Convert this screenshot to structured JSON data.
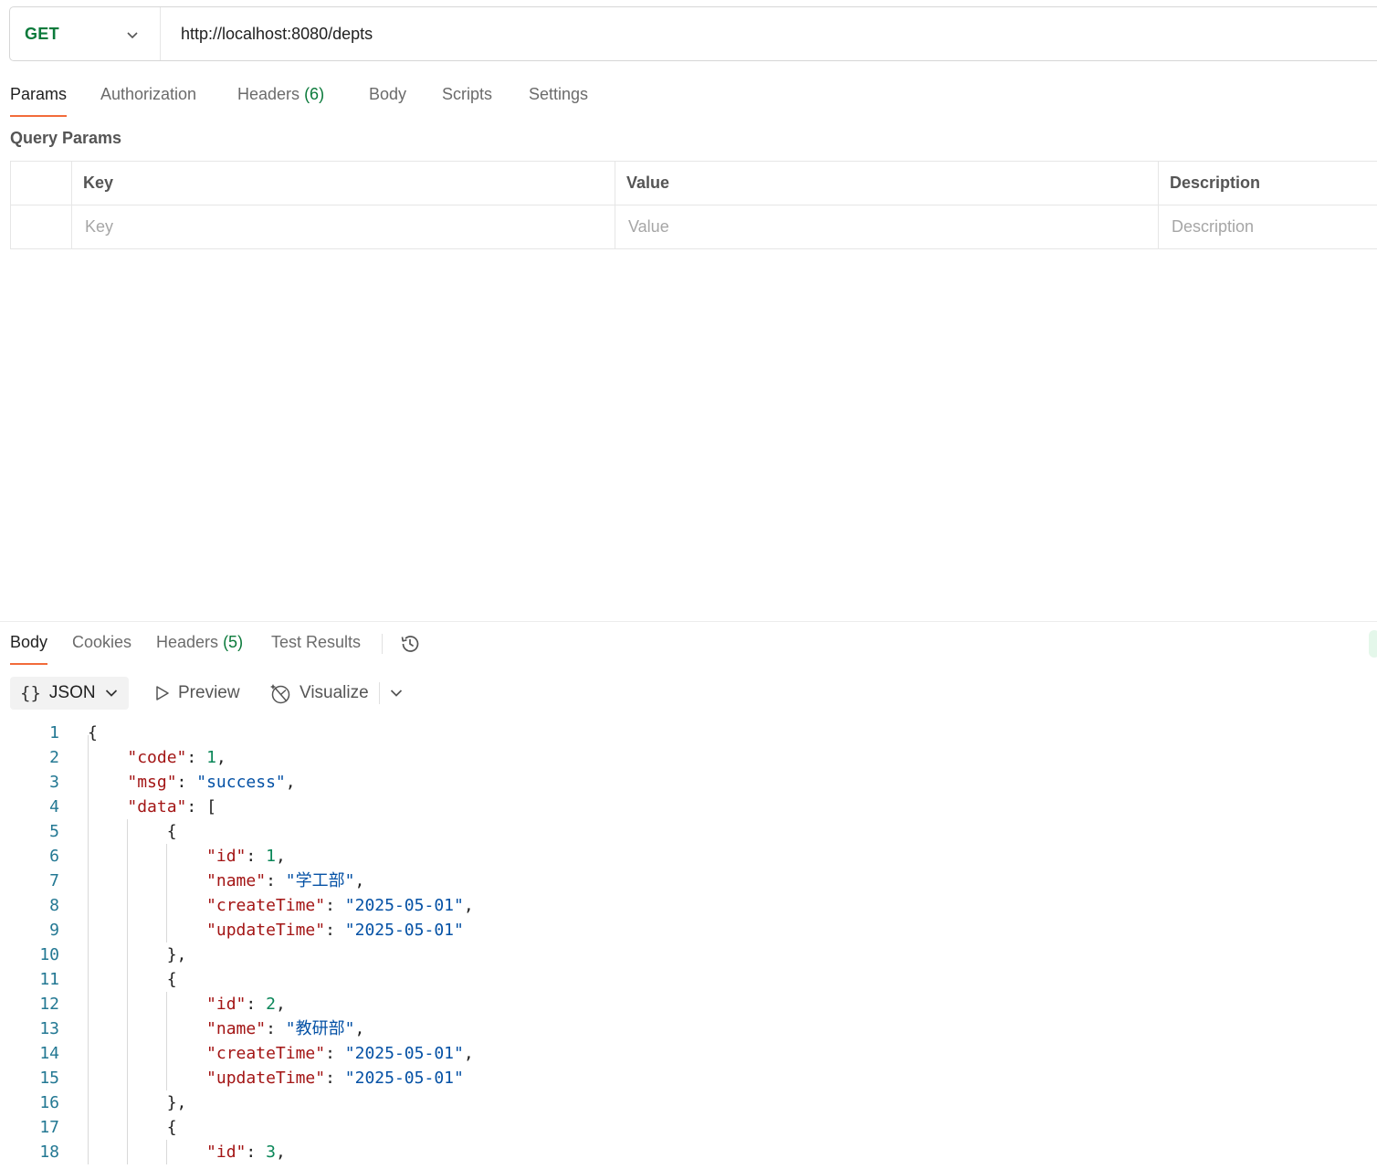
{
  "request": {
    "method": "GET",
    "url": "http://localhost:8080/depts",
    "tabs": [
      {
        "label": "Params"
      },
      {
        "label": "Authorization"
      },
      {
        "label": "Headers",
        "count": "(6)"
      },
      {
        "label": "Body"
      },
      {
        "label": "Scripts"
      },
      {
        "label": "Settings"
      }
    ],
    "active_tab": "Params"
  },
  "query_params": {
    "title": "Query Params",
    "columns": [
      "Key",
      "Value",
      "Description"
    ],
    "placeholders": {
      "key": "Key",
      "value": "Value",
      "description": "Description"
    }
  },
  "response": {
    "tabs": [
      {
        "label": "Body"
      },
      {
        "label": "Cookies"
      },
      {
        "label": "Headers",
        "count": "(5)"
      },
      {
        "label": "Test Results"
      }
    ],
    "active_tab": "Body",
    "format": "JSON",
    "preview_label": "Preview",
    "visualize_label": "Visualize",
    "body_lines": [
      "{",
      "    \"code\": 1,",
      "    \"msg\": \"success\",",
      "    \"data\": [",
      "        {",
      "            \"id\": 1,",
      "            \"name\": \"学工部\",",
      "            \"createTime\": \"2025-05-01\",",
      "            \"updateTime\": \"2025-05-01\"",
      "        },",
      "        {",
      "            \"id\": 2,",
      "            \"name\": \"教研部\",",
      "            \"createTime\": \"2025-05-01\",",
      "            \"updateTime\": \"2025-05-01\"",
      "        },",
      "        {",
      "            \"id\": 3,"
    ]
  },
  "colors": {
    "method_get": "#0b7a3b",
    "active_tab_underline": "#f26b3a",
    "json_key": "#a31515",
    "json_string": "#0451a5",
    "json_number": "#098658",
    "line_number": "#237893"
  },
  "icons": [
    "chevron-down-icon",
    "history-icon",
    "json-braces-icon",
    "play-icon",
    "visualize-icon"
  ]
}
